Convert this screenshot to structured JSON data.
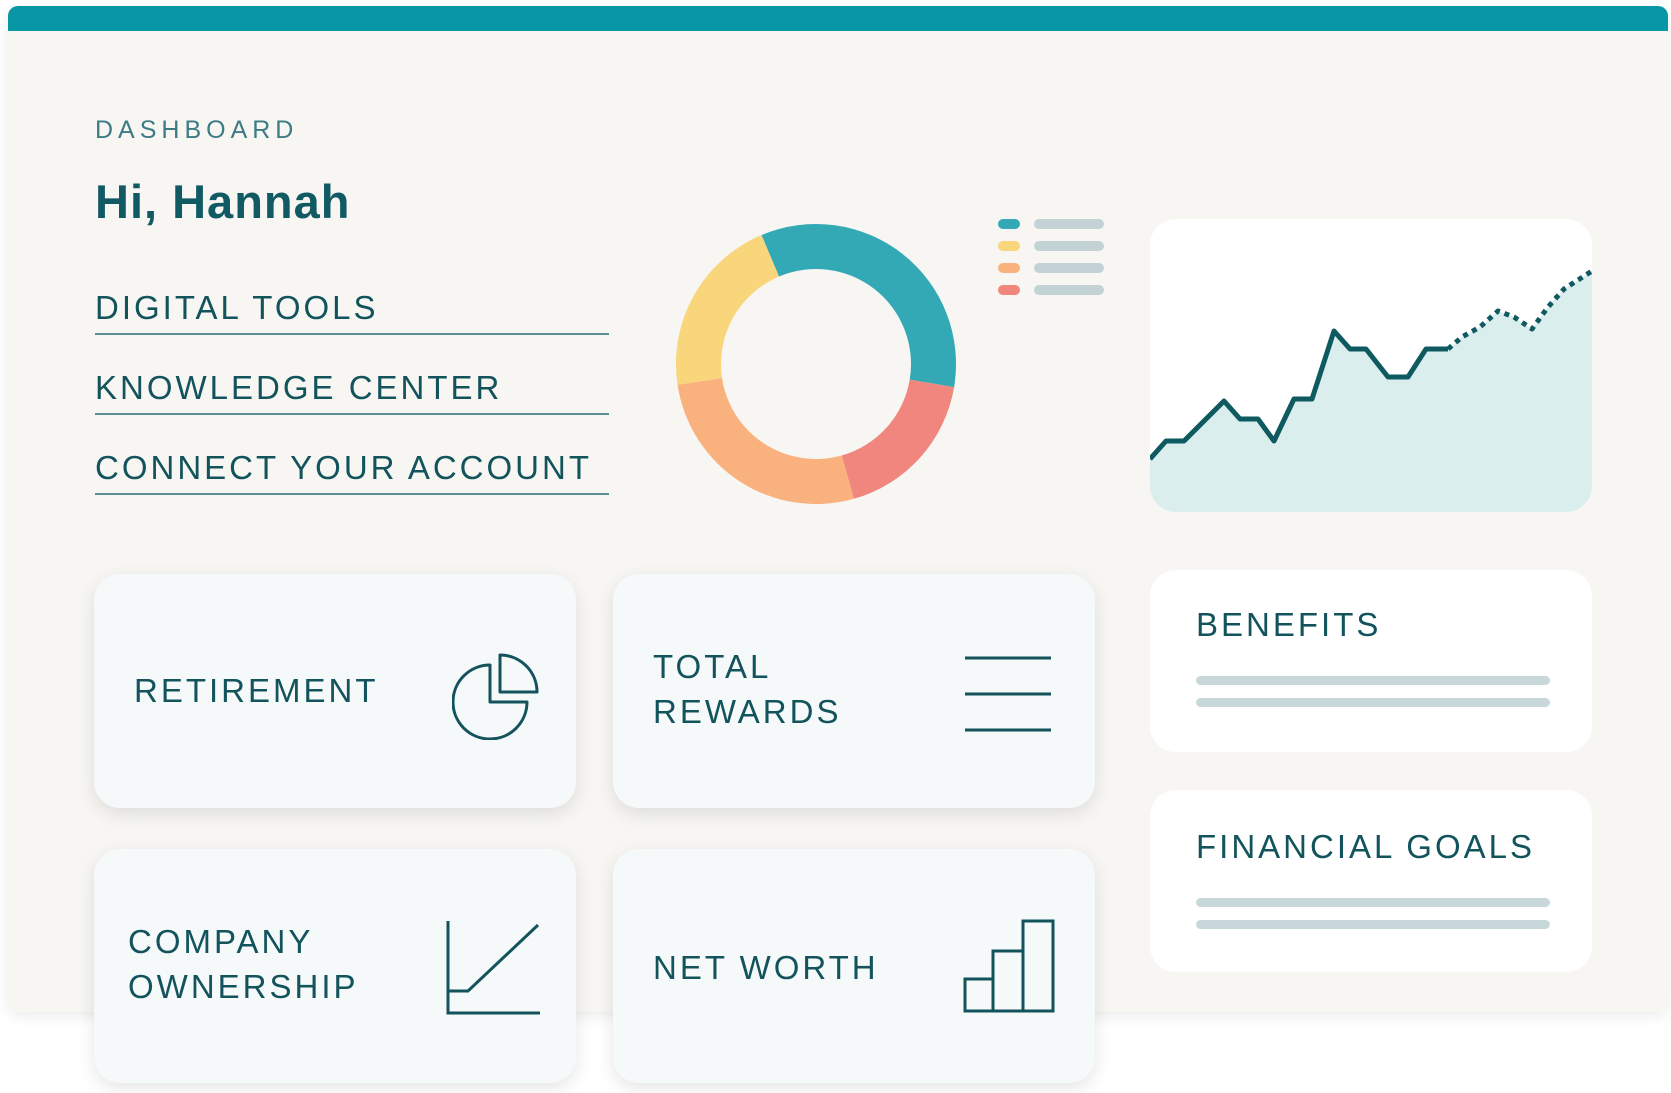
{
  "header": {
    "eyebrow": "DASHBOARD",
    "greeting": "Hi, Hannah"
  },
  "nav": {
    "items": [
      {
        "label": "DIGITAL TOOLS"
      },
      {
        "label": "KNOWLEDGE CENTER"
      },
      {
        "label": "CONNECT YOUR ACCOUNT"
      }
    ]
  },
  "donut": {
    "segments": [
      {
        "name": "teal",
        "color": "#33a9b5",
        "fraction": 0.34
      },
      {
        "name": "coral",
        "color": "#f0867d",
        "fraction": 0.18
      },
      {
        "name": "orange",
        "color": "#f9b27e",
        "fraction": 0.27
      },
      {
        "name": "yellow",
        "color": "#f9d57b",
        "fraction": 0.21
      }
    ]
  },
  "legend": {
    "colors": [
      "#33a9b5",
      "#f9d57b",
      "#f9b27e",
      "#f0867d"
    ]
  },
  "trend": {
    "line_color": "#0f5a61",
    "fill_color": "#d9eeed"
  },
  "tiles": {
    "retirement": {
      "label": "RETIREMENT",
      "icon": "pie-chart-icon"
    },
    "total_rewards": {
      "label_line1": "TOTAL",
      "label_line2": "REWARDS",
      "icon": "menu-lines-icon"
    },
    "company_ownership": {
      "label_line1": "COMPANY",
      "label_line2": "OWNERSHIP",
      "icon": "line-chart-icon"
    },
    "net_worth": {
      "label": "NET WORTH",
      "icon": "bar-chart-icon"
    }
  },
  "side_cards": {
    "benefits": {
      "label": "BENEFITS"
    },
    "financial_goals": {
      "label": "FINANCIAL GOALS"
    }
  }
}
